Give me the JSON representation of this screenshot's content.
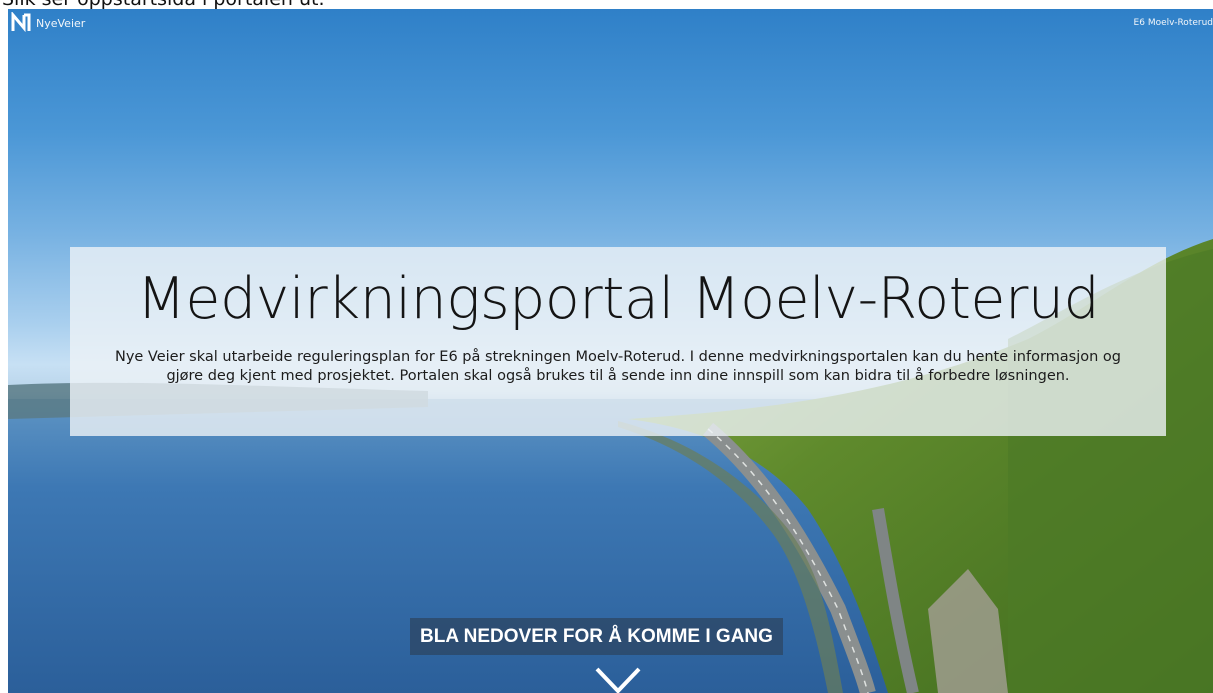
{
  "caption": "Slik ser oppstartsida i portalen ut.",
  "header": {
    "brand": "NyeVeier",
    "project_name": "E6 Moelv-Roterud"
  },
  "hero": {
    "title": "Medvirkningsportal Moelv-Roterud",
    "intro": "Nye Veier skal utarbeide reguleringsplan for E6 på strekningen Moelv-Roterud. I denne medvirkningsportalen kan du hente informasjon og gjøre deg kjent med prosjektet. Portalen skal også brukes til å sende inn dine innspill som kan bidra til å forbedre løsningen.",
    "scroll_label": "BLA NEDOVER FOR Å KOMME I GANG"
  },
  "icons": {
    "logo": "nye-veier-logo-icon",
    "scroll": "chevron-down-icon"
  }
}
